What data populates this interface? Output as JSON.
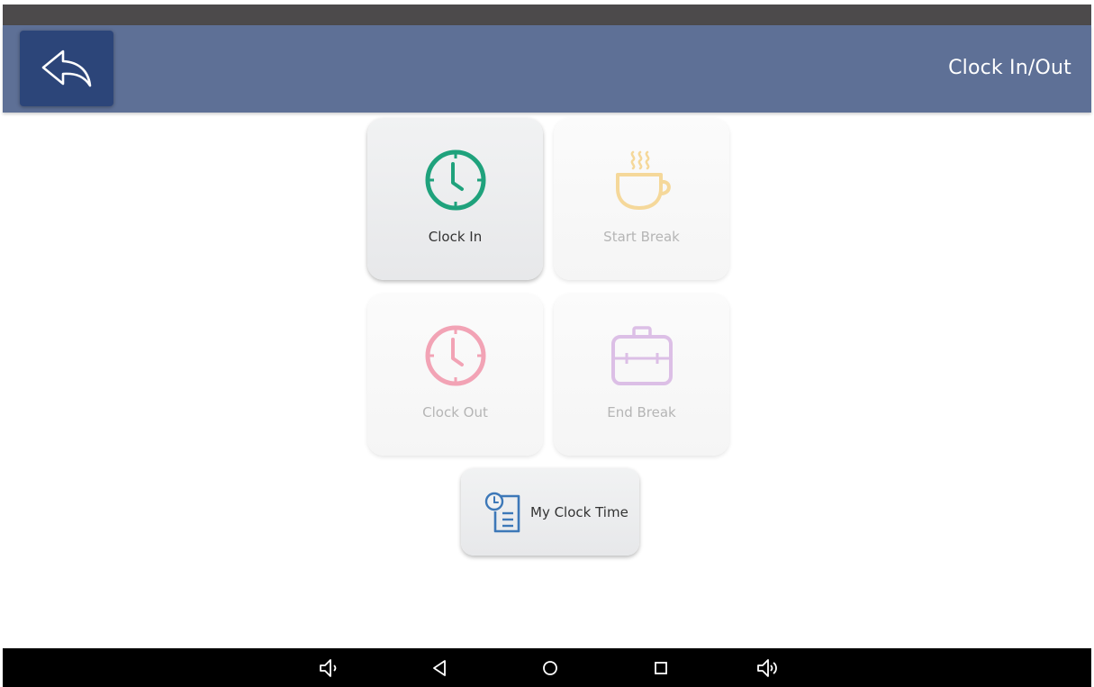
{
  "header": {
    "title": "Clock In/Out",
    "back_icon": "reply-arrow-icon"
  },
  "tiles": [
    {
      "label": "Clock In",
      "icon": "clock-icon",
      "color": "#1fa27c",
      "enabled": true
    },
    {
      "label": "Start Break",
      "icon": "coffee-cup-icon",
      "color": "#f5d89a",
      "enabled": false
    },
    {
      "label": "Clock Out",
      "icon": "clock-icon",
      "color": "#f2a3b5",
      "enabled": false
    },
    {
      "label": "End Break",
      "icon": "briefcase-icon",
      "color": "#dcbfe6",
      "enabled": false
    }
  ],
  "my_clock_time": {
    "label": "My Clock Time",
    "icon": "clock-document-icon",
    "color": "#3d78b8"
  },
  "nav_bar": {
    "icons": [
      "volume-down-icon",
      "back-triangle-icon",
      "home-circle-icon",
      "recents-square-icon",
      "volume-up-icon"
    ]
  },
  "colors": {
    "status_bar": "#4c4a4b",
    "app_bar": "#5e7096",
    "back_button": "#2c4579",
    "nav_bar": "#000000"
  }
}
